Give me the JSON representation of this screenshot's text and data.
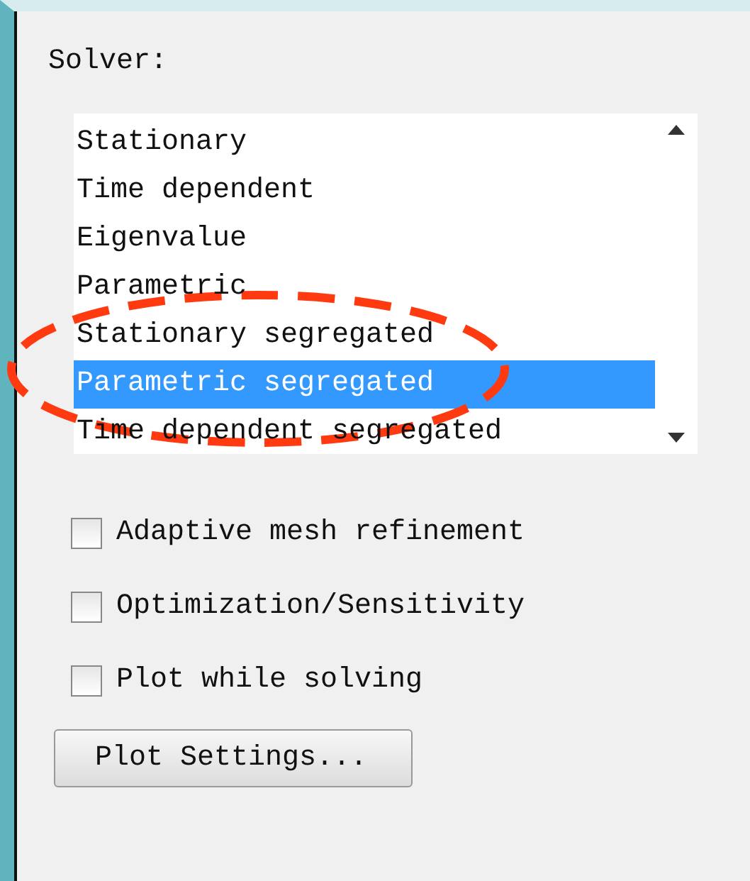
{
  "solver": {
    "label": "Solver:",
    "items": [
      {
        "label": "Stationary",
        "selected": false
      },
      {
        "label": "Time dependent",
        "selected": false
      },
      {
        "label": "Eigenvalue",
        "selected": false
      },
      {
        "label": "Parametric",
        "selected": false
      },
      {
        "label": "Stationary segregated",
        "selected": false
      },
      {
        "label": "Parametric segregated",
        "selected": true
      },
      {
        "label": "Time dependent segregated",
        "selected": false
      }
    ]
  },
  "options": [
    {
      "label": "Adaptive mesh refinement",
      "checked": false
    },
    {
      "label": "Optimization/Sensitivity",
      "checked": false
    },
    {
      "label": "Plot while solving",
      "checked": false
    }
  ],
  "button": "Plot Settings..."
}
